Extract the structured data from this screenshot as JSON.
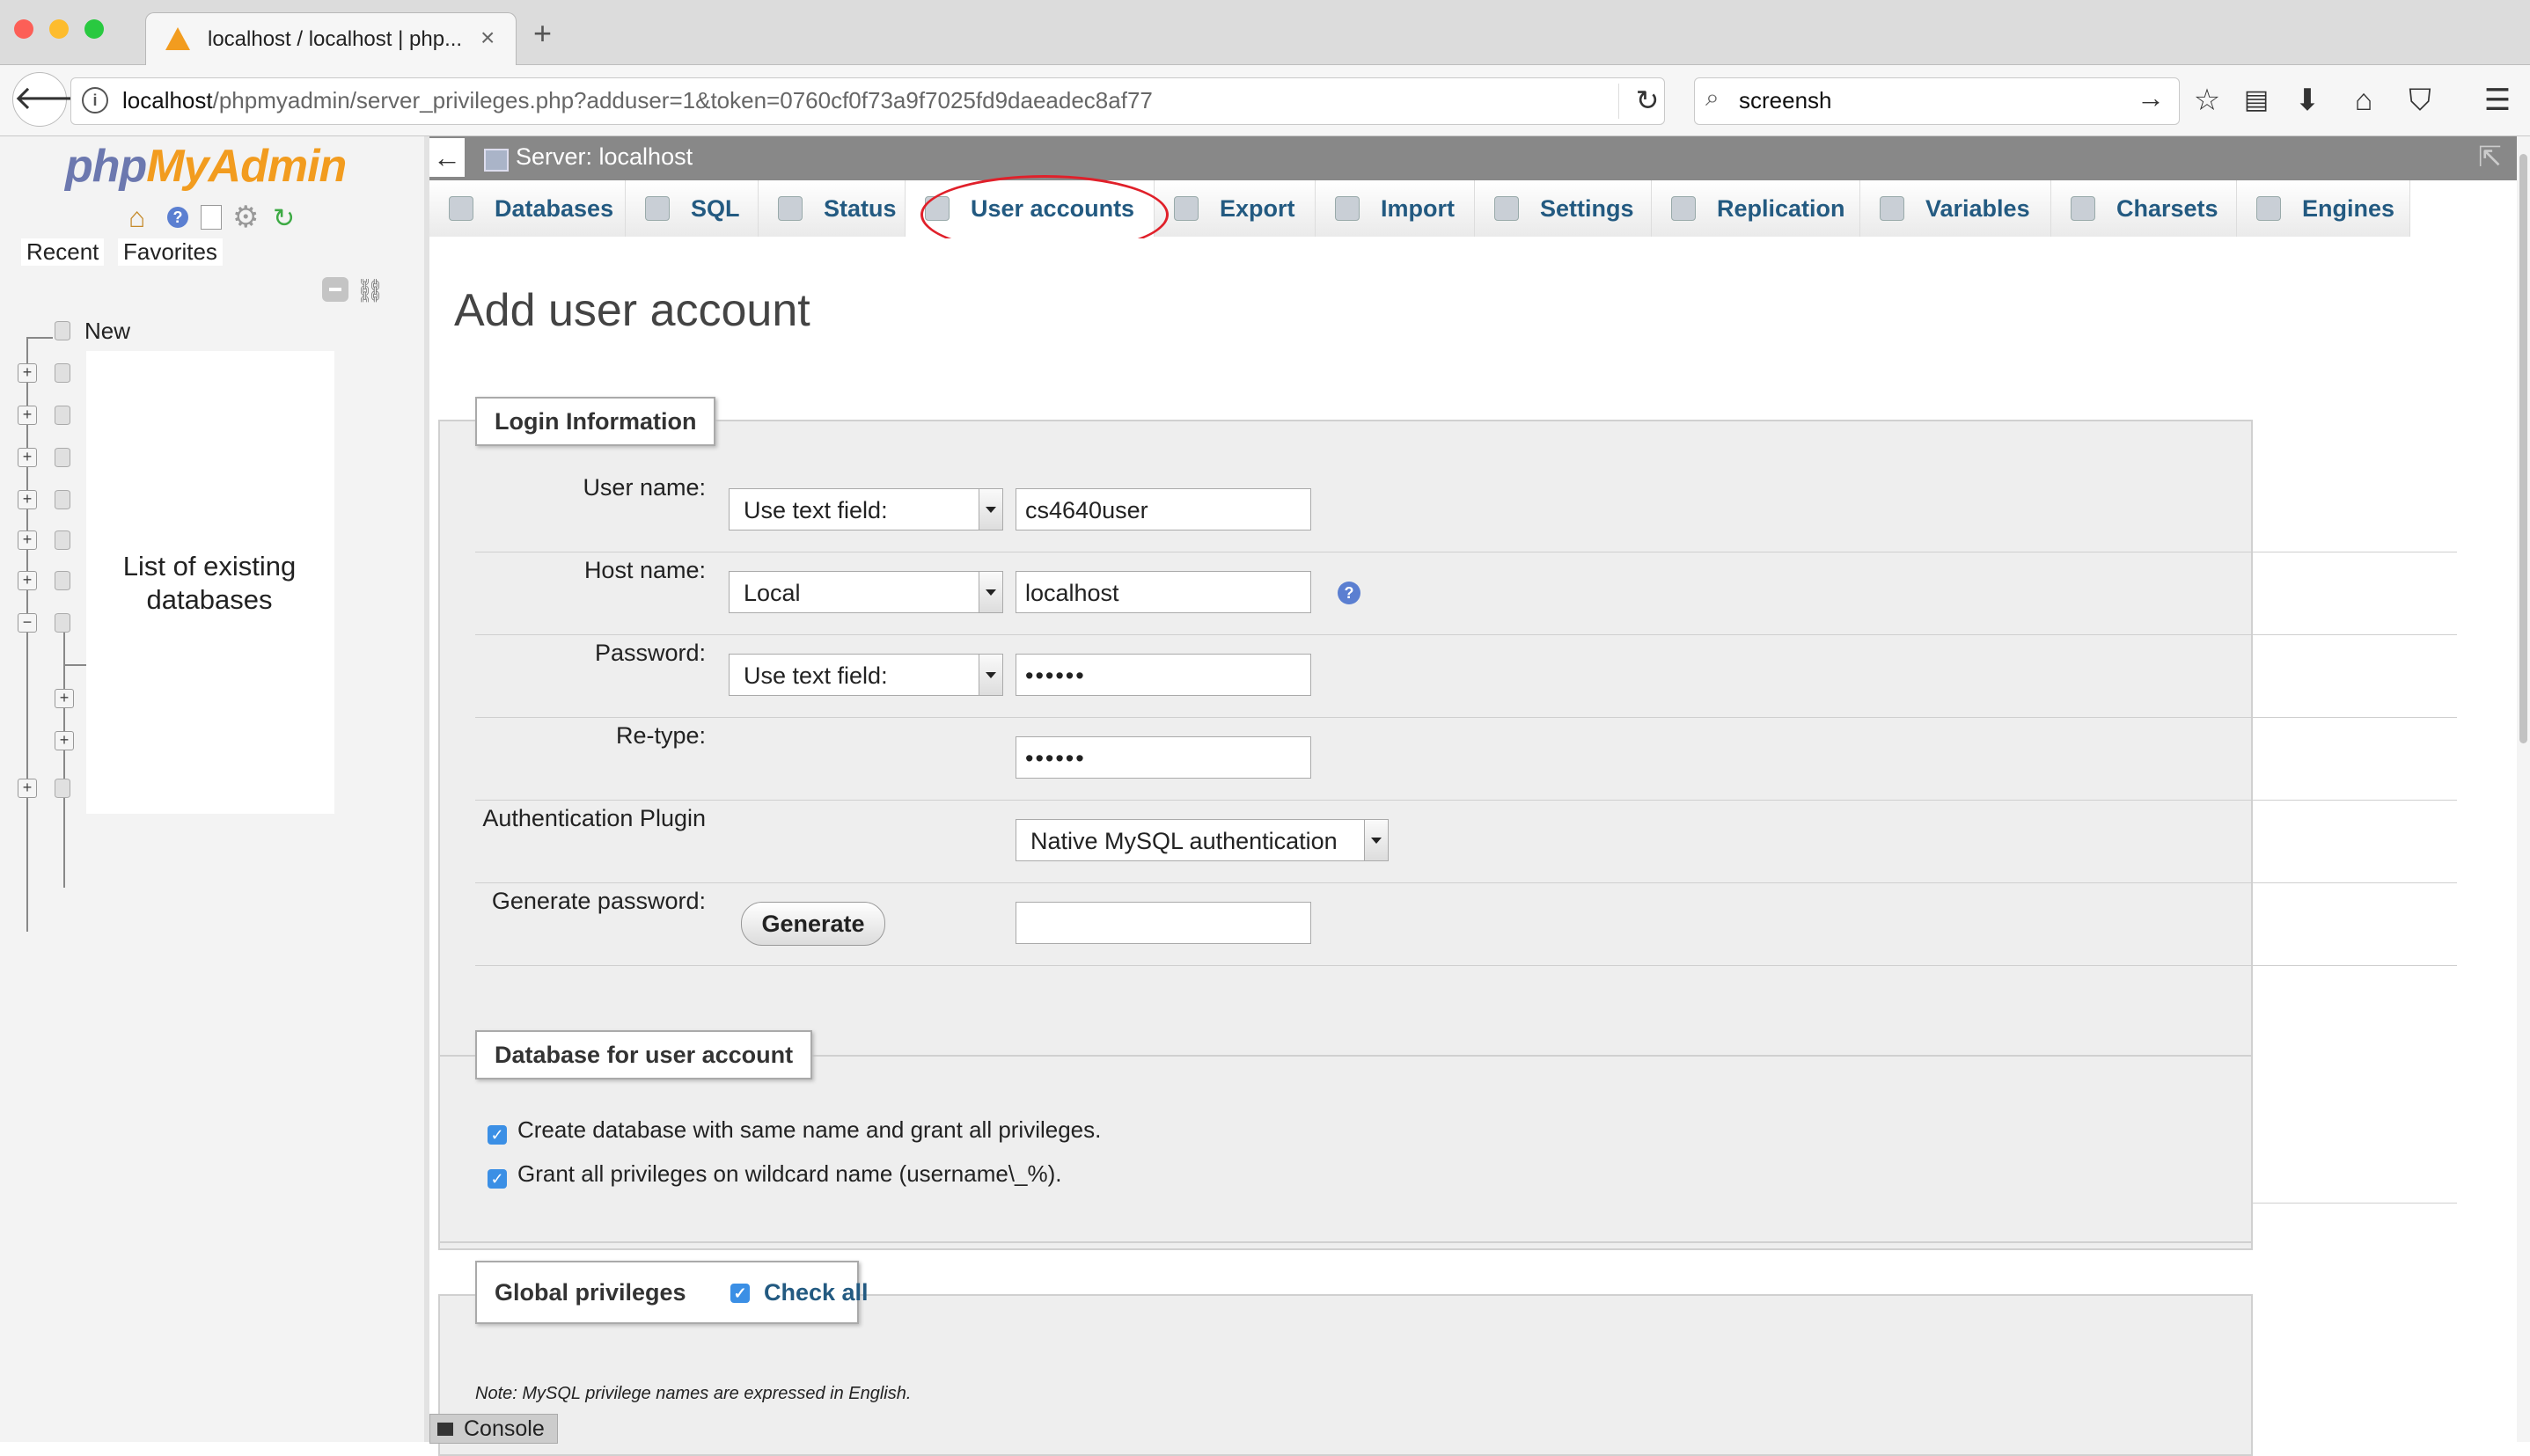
{
  "browser": {
    "tab_title": "localhost / localhost | php...",
    "tab_close": "×",
    "new_tab": "+",
    "url_host": "localhost",
    "url_path": "/phpmyadmin/server_privileges.php?adduser=1&token=0760cf0f73a9f7025fd9daeadec8af77",
    "search_value": "screensh"
  },
  "sidebar": {
    "logo_php": "php",
    "logo_myadmin": "MyAdmin",
    "recent": "Recent",
    "favorites": "Favorites",
    "new_label": "New",
    "db_note": "List of existing databases"
  },
  "serverbar": {
    "back_arrow": "←",
    "title": "Server: localhost",
    "collapse": "⇱"
  },
  "tabs": [
    {
      "label": "Databases"
    },
    {
      "label": "SQL"
    },
    {
      "label": "Status"
    },
    {
      "label": "User accounts"
    },
    {
      "label": "Export"
    },
    {
      "label": "Import"
    },
    {
      "label": "Settings"
    },
    {
      "label": "Replication"
    },
    {
      "label": "Variables"
    },
    {
      "label": "Charsets"
    },
    {
      "label": "Engines"
    }
  ],
  "annotation_color": "#e0202a",
  "page": {
    "title": "Add user account",
    "login": {
      "legend": "Login Information",
      "user_label": "User name:",
      "user_select": "Use text field:",
      "user_value": "cs4640user",
      "host_label": "Host name:",
      "host_select": "Local",
      "host_value": "localhost",
      "password_label": "Password:",
      "password_select": "Use text field:",
      "password_value": "••••••",
      "retype_label": "Re-type:",
      "retype_value": "••••••",
      "auth_label": "Authentication Plugin",
      "auth_select": "Native MySQL authentication",
      "generate_label": "Generate password:",
      "generate_button": "Generate",
      "generate_value": ""
    },
    "database": {
      "legend": "Database for user account",
      "option1": "Create database with same name and grant all privileges.",
      "option2": "Grant all privileges on wildcard name (username\\_%)."
    },
    "global": {
      "legend": "Global privileges",
      "check_all": "Check all",
      "note": "Note: MySQL privilege names are expressed in English."
    },
    "console": "Console"
  }
}
